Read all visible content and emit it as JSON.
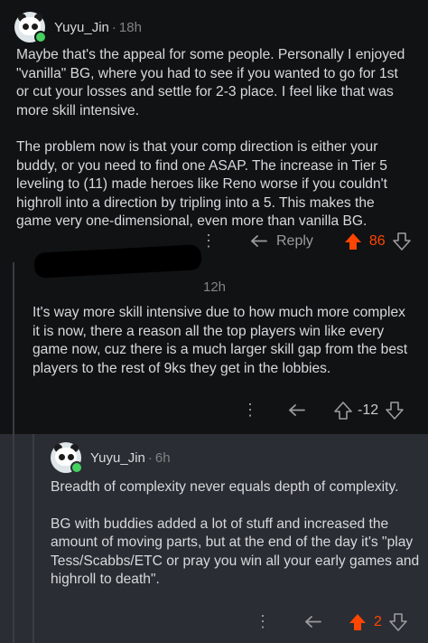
{
  "comments": [
    {
      "username": "Yuyu_Jin",
      "time": "18h",
      "paragraphs": [
        "Maybe that's the appeal for some people. Personally I enjoyed \"vanilla\" BG, where you had to see if you wanted to go for 1st or cut your losses and settle for 2-3 place. I feel like that was more skill intensive.",
        "The problem now is that your comp direction is either your buddy, or you need to find one ASAP. The increase in Tier 5 leveling to (11) made heroes like Reno worse if you couldn't highroll into a direction by tripling into a 5. This makes the game very one-dimensional, even more than vanilla BG."
      ],
      "reply_label": "Reply",
      "votes": "86",
      "vote_state": "upvoted"
    },
    {
      "username": "",
      "time": "12h",
      "paragraphs": [
        "It's way more skill intensive due to how much more complex it is now, there a reason all the top players win like every game now, cuz there is a much larger skill gap from the best players to the rest of 9ks they get in the lobbies."
      ],
      "votes": "-12",
      "vote_state": "none"
    },
    {
      "username": "Yuyu_Jin",
      "time": "6h",
      "paragraphs": [
        "Breadth of complexity never equals depth of complexity.",
        "BG with buddies added a lot of stuff and increased the amount of moving parts, but at the end of the day it's \"play Tess/Scabbs/ETC or pray you win all your early games and highroll to death\"."
      ],
      "votes": "2",
      "vote_state": "upvoted"
    }
  ],
  "colors": {
    "background": "#111213",
    "highlight_background": "#2a2d33",
    "upvote": "#ff4500",
    "text": "#d7dadc",
    "muted": "#818384",
    "online": "#46d160"
  }
}
